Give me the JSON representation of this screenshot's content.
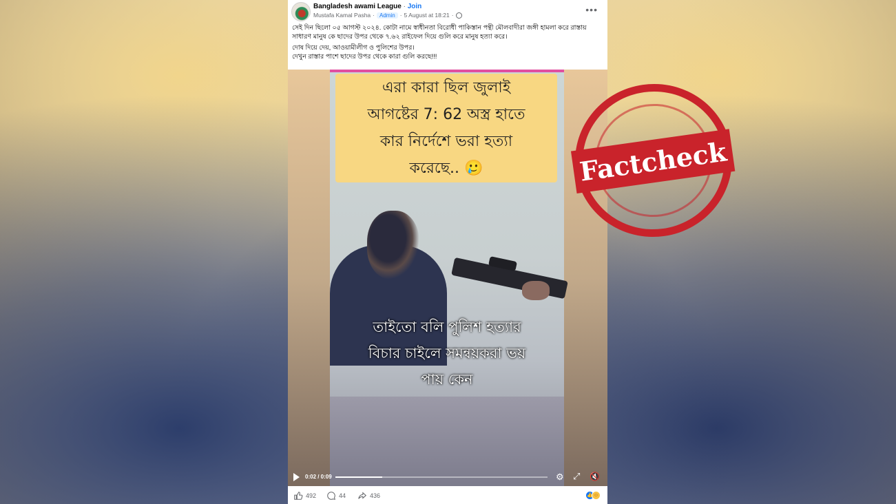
{
  "post": {
    "page_name": "Bangladesh awami League",
    "separator": "·",
    "join_label": "Join",
    "author": "Mustafa Kamal Pasha",
    "admin_badge": "Admin",
    "timestamp": "5 August at 18:21",
    "more_label": "•••",
    "caption_lines": [
      "সেই দিন ছিলো ০৫ আগস্ট ২০২৪. কোটা নামে স্বাধীনতা বিরোধী পাকিস্তান পন্থী মৌলবাদীরা জঙ্গী হামলা করে রাস্তায় সাধারণ মানুষ কে ছাদের উপর থেকে ৭.৬২ রাইফেল দিয়ে গুলি করে মানুষ হত্যা করে।",
      "দোষ দিয়ে দেয়, আওয়ামীলীগ ও পুলিশের উপর।",
      "দেখুন রাস্তার পাশে ছাদের উপর থেকে কারা গুলি করছে!!!"
    ]
  },
  "video": {
    "top_text_lines": [
      "এরা কারা ছিল জুলাই",
      "আগষ্টের 7: 62 অস্ত্র হাতে",
      "কার নির্দেশে ভরা হত্যা",
      "করেছে.. 🥲"
    ],
    "subtitle_lines": [
      "তাইতো বলি পুলিশ হত্যার",
      "বিচার চাইলে সমন্বয়করা ভয়",
      "পায় কেন"
    ],
    "time": "0:02 / 0:09",
    "progress_fraction": 0.22
  },
  "footer": {
    "likes": "492",
    "comments": "44",
    "shares": "436"
  },
  "stamp": {
    "text": "Factcheck"
  },
  "colors": {
    "facebook_blue": "#1877f2",
    "stamp_red": "#c9232b",
    "text_box_yellow": "#f8d782"
  },
  "icons": [
    "play-icon",
    "settings-gear-icon",
    "fullscreen-icon",
    "mute-icon",
    "like-icon",
    "comment-icon",
    "share-icon",
    "globe-icon",
    "more-options-icon"
  ]
}
